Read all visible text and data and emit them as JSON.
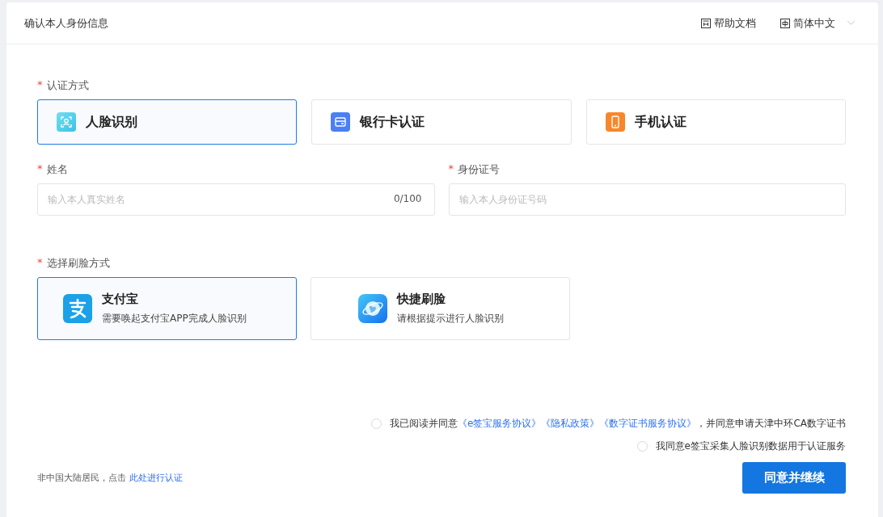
{
  "header": {
    "title": "确认本人身份信息",
    "help": "帮助文档",
    "language": "简体中文"
  },
  "method_section": {
    "required": "*",
    "label": "认证方式",
    "options": [
      {
        "kind": "face",
        "label": "人脸识别",
        "selected": true
      },
      {
        "kind": "bank",
        "label": "银行卡认证",
        "selected": false
      },
      {
        "kind": "phone",
        "label": "手机认证",
        "selected": false
      }
    ]
  },
  "fields": [
    {
      "required": "*",
      "label": "姓名",
      "placeholder": "输入本人真实姓名",
      "counter": "0/100"
    },
    {
      "required": "*",
      "label": "身份证号",
      "placeholder": "输入本人身份证号码"
    }
  ],
  "face_section": {
    "required": "*",
    "label": "选择刷脸方式",
    "options": [
      {
        "kind": "alipay",
        "title": "支付宝",
        "subtitle": "需要唤起支付宝APP完成人脸识别",
        "selected": true
      },
      {
        "kind": "quick",
        "title": "快捷刷脸",
        "subtitle": "请根据提示进行人脸识别",
        "selected": false
      }
    ]
  },
  "agreements": [
    {
      "checked": false,
      "parts": [
        {
          "kind": "text",
          "text": "我已阅读并同意"
        },
        {
          "kind": "link",
          "text": "《e签宝服务协议》"
        },
        {
          "kind": "link",
          "text": "《隐私政策》"
        },
        {
          "kind": "link",
          "text": "《数字证书服务协议》"
        },
        {
          "kind": "text",
          "text": "，并同意申请天津中环CA数字证书"
        }
      ]
    },
    {
      "checked": false,
      "parts": [
        {
          "kind": "text",
          "text": "我同意e签宝采集人脸识别数据用于认证服务"
        }
      ]
    }
  ],
  "footer": {
    "note": "非中国大陆居民，点击",
    "link": "此处进行认证",
    "button": "同意并继续"
  }
}
